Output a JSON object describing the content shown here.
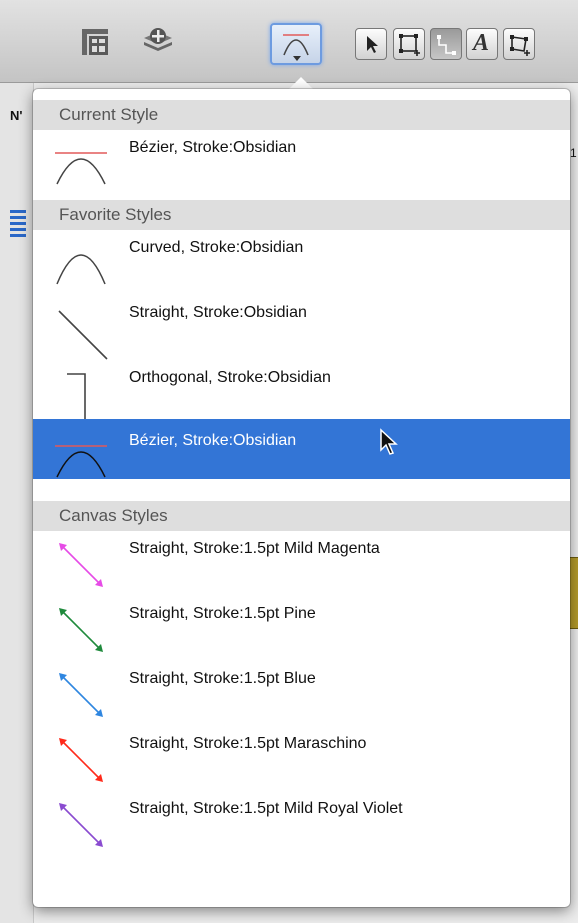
{
  "menu": {
    "sections": [
      {
        "header": "Current Style",
        "items": [
          {
            "label": "Bézier, Stroke:Obsidian",
            "icon": "bezier-line-icon",
            "color": "#444444"
          }
        ]
      },
      {
        "header": "Favorite Styles",
        "items": [
          {
            "label": "Curved, Stroke:Obsidian",
            "icon": "curved-line-icon",
            "color": "#444444"
          },
          {
            "label": "Straight, Stroke:Obsidian",
            "icon": "straight-line-icon",
            "color": "#444444"
          },
          {
            "label": "Orthogonal, Stroke:Obsidian",
            "icon": "orthogonal-line-icon",
            "color": "#444444"
          },
          {
            "label": "Bézier, Stroke:Obsidian",
            "icon": "bezier-line-icon",
            "color": "#222222",
            "selected": true
          }
        ]
      },
      {
        "header": "Canvas Styles",
        "items": [
          {
            "label": "Straight, Stroke:1.5pt Mild Magenta",
            "icon": "arrow-line-icon",
            "color": "#e64be6"
          },
          {
            "label": "Straight, Stroke:1.5pt Pine",
            "icon": "arrow-line-icon",
            "color": "#1f8a3c"
          },
          {
            "label": "Straight, Stroke:1.5pt Blue",
            "icon": "arrow-line-icon",
            "color": "#2f86e0"
          },
          {
            "label": "Straight, Stroke:1.5pt Maraschino",
            "icon": "arrow-line-icon",
            "color": "#ff2a1a"
          },
          {
            "label": "Straight, Stroke:1.5pt Mild Royal Violet",
            "icon": "arrow-line-icon",
            "color": "#8a4bd0"
          }
        ]
      }
    ]
  },
  "toolbar": {
    "icons": [
      "table-insert-icon",
      "layers-add-icon",
      "line-style-icon",
      "pointer-tool-icon",
      "shape-tool-icon",
      "line-tool-icon",
      "text-tool-icon",
      "diagram-tool-icon"
    ]
  },
  "backdrop": {
    "fragment_text": "N'",
    "edge_number": "1"
  },
  "colors": {
    "selection": "#3375d6",
    "section_header_bg": "#dedede",
    "accent_curve": "#e25a5a"
  }
}
